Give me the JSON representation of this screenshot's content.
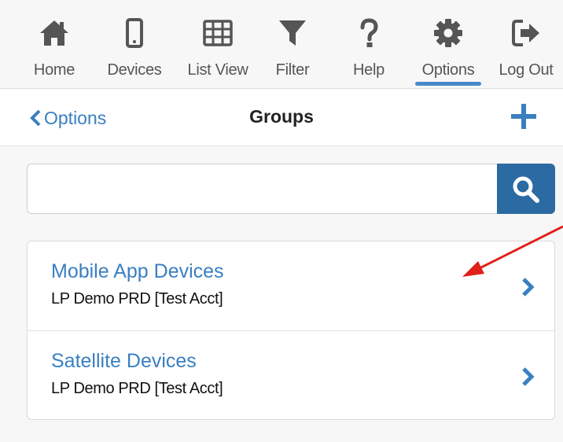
{
  "nav": {
    "items": [
      {
        "label": "Home",
        "icon": "home-icon"
      },
      {
        "label": "Devices",
        "icon": "mobile-icon"
      },
      {
        "label": "List View",
        "icon": "table-icon"
      },
      {
        "label": "Filter",
        "icon": "filter-icon"
      },
      {
        "label": "Help",
        "icon": "question-icon"
      },
      {
        "label": "Options",
        "icon": "gear-icon"
      },
      {
        "label": "Log Out",
        "icon": "sign-out-icon"
      }
    ],
    "active": "Options"
  },
  "header": {
    "back_label": "Options",
    "title": "Groups"
  },
  "search": {
    "value": "",
    "placeholder": ""
  },
  "groups": [
    {
      "name": "Mobile App Devices",
      "account": "LP Demo PRD [Test Acct]"
    },
    {
      "name": "Satellite Devices",
      "account": "LP Demo PRD [Test Acct]"
    }
  ],
  "colors": {
    "accent": "#3a7fc1",
    "search_button": "#2b6aa3",
    "nav_icon": "#555555",
    "annotation_arrow": "#e0201a"
  }
}
